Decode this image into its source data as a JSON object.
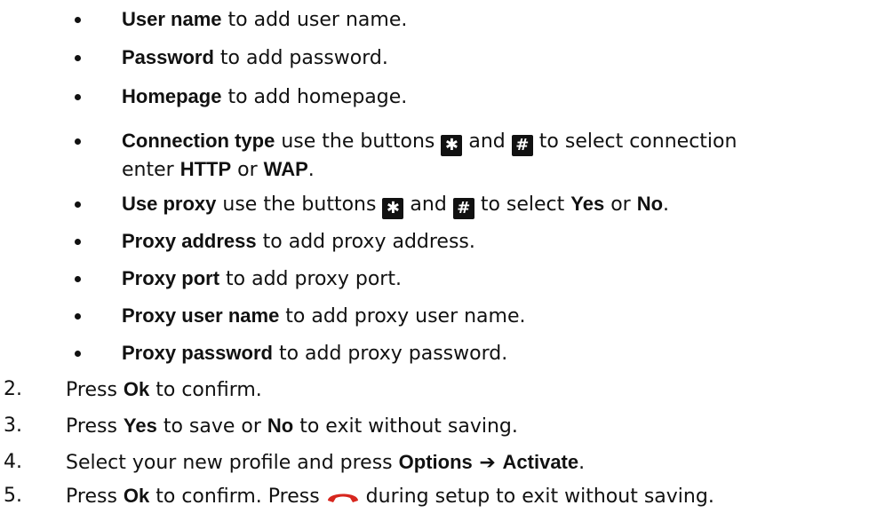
{
  "bullets": [
    {
      "term": "User name",
      "rest": " to add user name."
    },
    {
      "term": "Password",
      "rest": " to add password."
    },
    {
      "term": "Homepage",
      "rest": " to add homepage."
    },
    {
      "term": "Connection type",
      "rest1": " use the buttons ",
      "and": " and ",
      "rest2": " to select connection",
      "line2_pre": "enter ",
      "opt1": "HTTP",
      "or": " or ",
      "opt2": "WAP",
      "end": "."
    },
    {
      "term": "Use proxy",
      "rest1": " use the buttons ",
      "and": " and ",
      "rest2": " to select ",
      "opt1": "Yes",
      "or": " or ",
      "opt2": "No",
      "end": "."
    },
    {
      "term": "Proxy address",
      "rest": " to add proxy address."
    },
    {
      "term": "Proxy port",
      "rest": " to add proxy port."
    },
    {
      "term": "Proxy user name",
      "rest": " to add proxy user name."
    },
    {
      "term": "Proxy password",
      "rest": " to add proxy password."
    }
  ],
  "keys": {
    "star": "✱",
    "hash": "#"
  },
  "steps": [
    {
      "num": "2.",
      "pre": "Press ",
      "b1": "Ok",
      "post": " to confirm."
    },
    {
      "num": "3.",
      "pre": "Press ",
      "b1": "Yes",
      "mid": " to save or ",
      "b2": "No",
      "post": " to exit without saving."
    },
    {
      "num": "4.",
      "pre": "Select your new profile and press ",
      "b1": "Options",
      "arrow": " ➔ ",
      "b2": "Activate",
      "post": "."
    },
    {
      "num": "5.",
      "pre": "Press ",
      "b1": "Ok",
      "mid": " to confirm. Press ",
      "post": " during setup to exit without saving."
    }
  ],
  "colors": {
    "hangup": "#d7261e",
    "text": "#111111"
  },
  "icons": {
    "hangup": "end-call-icon"
  }
}
